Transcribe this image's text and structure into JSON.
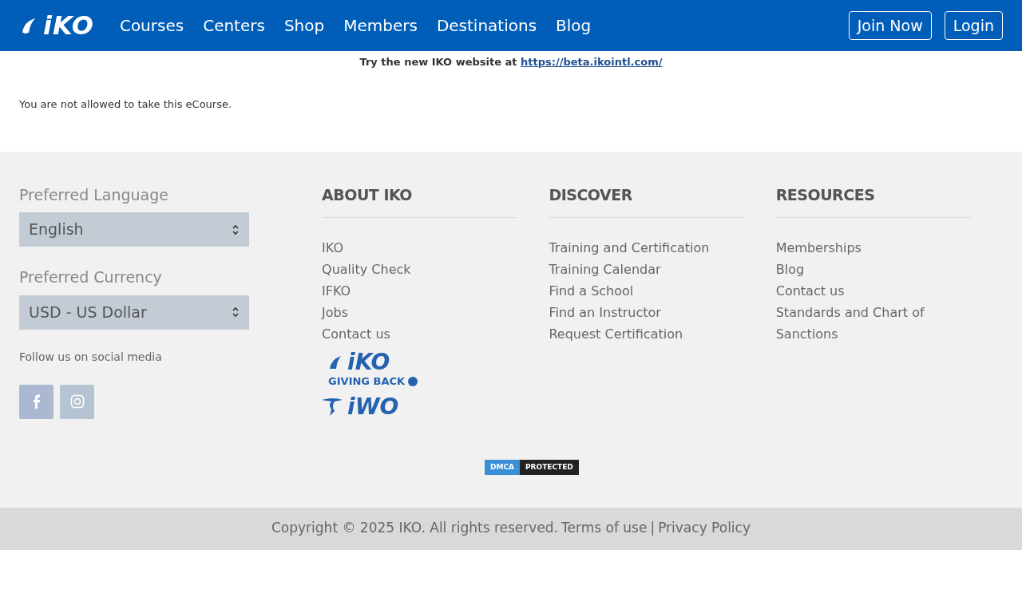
{
  "navbar": {
    "logo": "iKO",
    "links": [
      "Courses",
      "Centers",
      "Shop",
      "Members",
      "Destinations",
      "Blog"
    ],
    "buttons": [
      "Join Now",
      "Login"
    ]
  },
  "notice": {
    "text": "Try the new IKO website at ",
    "link": "https://beta.ikointl.com/"
  },
  "message": "You are not allowed to take this eCourse.",
  "footer": {
    "language": {
      "label": "Preferred Language",
      "value": "English"
    },
    "currency": {
      "label": "Preferred Currency",
      "value": "USD - US Dollar"
    },
    "social_label": "Follow us on social media",
    "social": [
      {
        "kind": "facebook",
        "color": "#aab8d2"
      },
      {
        "kind": "instagram",
        "color": "#b5c4d2"
      }
    ],
    "columns": [
      {
        "title": "ABOUT IKO",
        "links": [
          "IKO",
          "Quality Check",
          "IFKO",
          "Jobs",
          "Contact us"
        ]
      },
      {
        "title": "DISCOVER",
        "links": [
          "Training and Certification",
          "Training Calendar",
          "Find a School",
          "Find an Instructor",
          "Request Certification"
        ]
      },
      {
        "title": "RESOURCES",
        "links": [
          "Memberships",
          "Blog",
          "Contact us",
          "Standards and Chart of Sanctions"
        ]
      }
    ],
    "logos": [
      {
        "kind": "giving-back",
        "title": "iKO",
        "subtitle": "GIVING BACK"
      },
      {
        "kind": "iwo",
        "title": "iWO"
      }
    ],
    "dmca": [
      "DMCA",
      "PROTECTED"
    ]
  },
  "bottom": {
    "copyright": "Copyright © 2025 IKO. All rights reserved.",
    "links": [
      "Terms of use",
      "Privacy Policy"
    ],
    "separator": "|"
  }
}
